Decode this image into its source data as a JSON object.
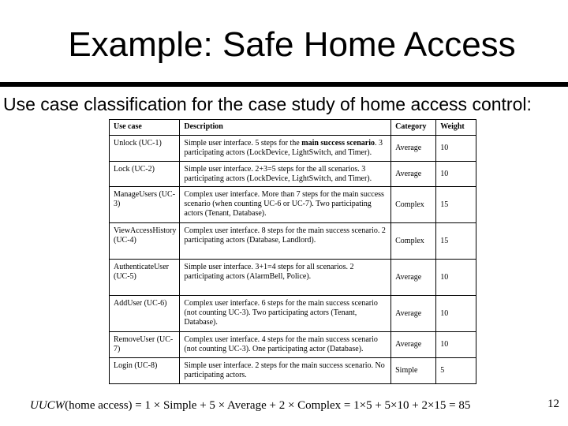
{
  "slide": {
    "title": "Example: Safe Home Access",
    "subtitle": "Use case classification for the case study of home access control:",
    "page_number": "12"
  },
  "table": {
    "headers": [
      "Use case",
      "Description",
      "Category",
      "Weight"
    ],
    "rows": [
      {
        "use_case": "Unlock (UC-1)",
        "desc_pre": "Simple user interface. 5 steps for the ",
        "desc_bold": "main success scenario",
        "desc_post": ". 3 participating actors (LockDevice, LightSwitch, and Timer).",
        "category": "Average",
        "weight": "10"
      },
      {
        "use_case": "Lock (UC-2)",
        "desc_pre": "Simple user interface. 2+3=5 steps for the all scenarios. 3 participating actors (LockDevice, LightSwitch, and Timer).",
        "desc_bold": "",
        "desc_post": "",
        "category": "Average",
        "weight": "10"
      },
      {
        "use_case": "ManageUsers (UC-3)",
        "desc_pre": "Complex user interface. More than 7 steps for the main success scenario (when counting UC-6 or UC-7). Two participating actors (Tenant, Database).",
        "desc_bold": "",
        "desc_post": "",
        "category": "Complex",
        "weight": "15"
      },
      {
        "use_case": "ViewAccessHistory (UC-4)",
        "desc_pre": "Complex user interface. 8 steps for the main success scenario. 2 participating actors (Database, Landlord).",
        "desc_bold": "",
        "desc_post": "",
        "category": "Complex",
        "weight": "15"
      },
      {
        "use_case": "AuthenticateUser (UC-5)",
        "desc_pre": "Simple user interface. 3+1=4 steps for all scenarios. 2 participating actors (AlarmBell, Police).",
        "desc_bold": "",
        "desc_post": "",
        "category": "Average",
        "weight": "10"
      },
      {
        "use_case": "AddUser (UC-6)",
        "desc_pre": "Complex user interface. 6 steps for the main success scenario (not counting UC-3). Two participating actors (Tenant, Database).",
        "desc_bold": "",
        "desc_post": "",
        "category": "Average",
        "weight": "10"
      },
      {
        "use_case": "RemoveUser (UC-7)",
        "desc_pre": "Complex user interface. 4 steps for the main success scenario (not counting UC-3). One participating actor (Database).",
        "desc_bold": "",
        "desc_post": "",
        "category": "Average",
        "weight": "10"
      },
      {
        "use_case": "Login (UC-8)",
        "desc_pre": "Simple user interface. 2 steps for the main success scenario. No participating actors.",
        "desc_bold": "",
        "desc_post": "",
        "category": "Simple",
        "weight": "5"
      }
    ]
  },
  "formula": {
    "lhs_italic": "UUCW",
    "rest": "(home access) = 1 × Simple + 5 × Average + 2 × Complex = 1×5 + 5×10 + 2×15 = 85"
  }
}
